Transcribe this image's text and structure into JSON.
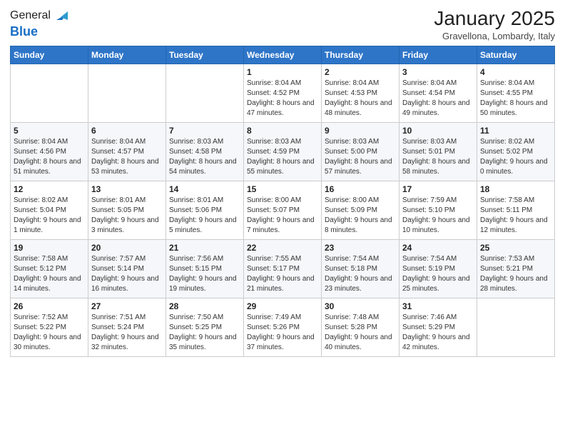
{
  "logo": {
    "general": "General",
    "blue": "Blue"
  },
  "header": {
    "month": "January 2025",
    "location": "Gravellona, Lombardy, Italy"
  },
  "weekdays": [
    "Sunday",
    "Monday",
    "Tuesday",
    "Wednesday",
    "Thursday",
    "Friday",
    "Saturday"
  ],
  "weeks": [
    [
      {
        "day": "",
        "info": ""
      },
      {
        "day": "",
        "info": ""
      },
      {
        "day": "",
        "info": ""
      },
      {
        "day": "1",
        "info": "Sunrise: 8:04 AM\nSunset: 4:52 PM\nDaylight: 8 hours\nand 47 minutes."
      },
      {
        "day": "2",
        "info": "Sunrise: 8:04 AM\nSunset: 4:53 PM\nDaylight: 8 hours\nand 48 minutes."
      },
      {
        "day": "3",
        "info": "Sunrise: 8:04 AM\nSunset: 4:54 PM\nDaylight: 8 hours\nand 49 minutes."
      },
      {
        "day": "4",
        "info": "Sunrise: 8:04 AM\nSunset: 4:55 PM\nDaylight: 8 hours\nand 50 minutes."
      }
    ],
    [
      {
        "day": "5",
        "info": "Sunrise: 8:04 AM\nSunset: 4:56 PM\nDaylight: 8 hours\nand 51 minutes."
      },
      {
        "day": "6",
        "info": "Sunrise: 8:04 AM\nSunset: 4:57 PM\nDaylight: 8 hours\nand 53 minutes."
      },
      {
        "day": "7",
        "info": "Sunrise: 8:03 AM\nSunset: 4:58 PM\nDaylight: 8 hours\nand 54 minutes."
      },
      {
        "day": "8",
        "info": "Sunrise: 8:03 AM\nSunset: 4:59 PM\nDaylight: 8 hours\nand 55 minutes."
      },
      {
        "day": "9",
        "info": "Sunrise: 8:03 AM\nSunset: 5:00 PM\nDaylight: 8 hours\nand 57 minutes."
      },
      {
        "day": "10",
        "info": "Sunrise: 8:03 AM\nSunset: 5:01 PM\nDaylight: 8 hours\nand 58 minutes."
      },
      {
        "day": "11",
        "info": "Sunrise: 8:02 AM\nSunset: 5:02 PM\nDaylight: 9 hours\nand 0 minutes."
      }
    ],
    [
      {
        "day": "12",
        "info": "Sunrise: 8:02 AM\nSunset: 5:04 PM\nDaylight: 9 hours\nand 1 minute."
      },
      {
        "day": "13",
        "info": "Sunrise: 8:01 AM\nSunset: 5:05 PM\nDaylight: 9 hours\nand 3 minutes."
      },
      {
        "day": "14",
        "info": "Sunrise: 8:01 AM\nSunset: 5:06 PM\nDaylight: 9 hours\nand 5 minutes."
      },
      {
        "day": "15",
        "info": "Sunrise: 8:00 AM\nSunset: 5:07 PM\nDaylight: 9 hours\nand 7 minutes."
      },
      {
        "day": "16",
        "info": "Sunrise: 8:00 AM\nSunset: 5:09 PM\nDaylight: 9 hours\nand 8 minutes."
      },
      {
        "day": "17",
        "info": "Sunrise: 7:59 AM\nSunset: 5:10 PM\nDaylight: 9 hours\nand 10 minutes."
      },
      {
        "day": "18",
        "info": "Sunrise: 7:58 AM\nSunset: 5:11 PM\nDaylight: 9 hours\nand 12 minutes."
      }
    ],
    [
      {
        "day": "19",
        "info": "Sunrise: 7:58 AM\nSunset: 5:12 PM\nDaylight: 9 hours\nand 14 minutes."
      },
      {
        "day": "20",
        "info": "Sunrise: 7:57 AM\nSunset: 5:14 PM\nDaylight: 9 hours\nand 16 minutes."
      },
      {
        "day": "21",
        "info": "Sunrise: 7:56 AM\nSunset: 5:15 PM\nDaylight: 9 hours\nand 19 minutes."
      },
      {
        "day": "22",
        "info": "Sunrise: 7:55 AM\nSunset: 5:17 PM\nDaylight: 9 hours\nand 21 minutes."
      },
      {
        "day": "23",
        "info": "Sunrise: 7:54 AM\nSunset: 5:18 PM\nDaylight: 9 hours\nand 23 minutes."
      },
      {
        "day": "24",
        "info": "Sunrise: 7:54 AM\nSunset: 5:19 PM\nDaylight: 9 hours\nand 25 minutes."
      },
      {
        "day": "25",
        "info": "Sunrise: 7:53 AM\nSunset: 5:21 PM\nDaylight: 9 hours\nand 28 minutes."
      }
    ],
    [
      {
        "day": "26",
        "info": "Sunrise: 7:52 AM\nSunset: 5:22 PM\nDaylight: 9 hours\nand 30 minutes."
      },
      {
        "day": "27",
        "info": "Sunrise: 7:51 AM\nSunset: 5:24 PM\nDaylight: 9 hours\nand 32 minutes."
      },
      {
        "day": "28",
        "info": "Sunrise: 7:50 AM\nSunset: 5:25 PM\nDaylight: 9 hours\nand 35 minutes."
      },
      {
        "day": "29",
        "info": "Sunrise: 7:49 AM\nSunset: 5:26 PM\nDaylight: 9 hours\nand 37 minutes."
      },
      {
        "day": "30",
        "info": "Sunrise: 7:48 AM\nSunset: 5:28 PM\nDaylight: 9 hours\nand 40 minutes."
      },
      {
        "day": "31",
        "info": "Sunrise: 7:46 AM\nSunset: 5:29 PM\nDaylight: 9 hours\nand 42 minutes."
      },
      {
        "day": "",
        "info": ""
      }
    ]
  ]
}
